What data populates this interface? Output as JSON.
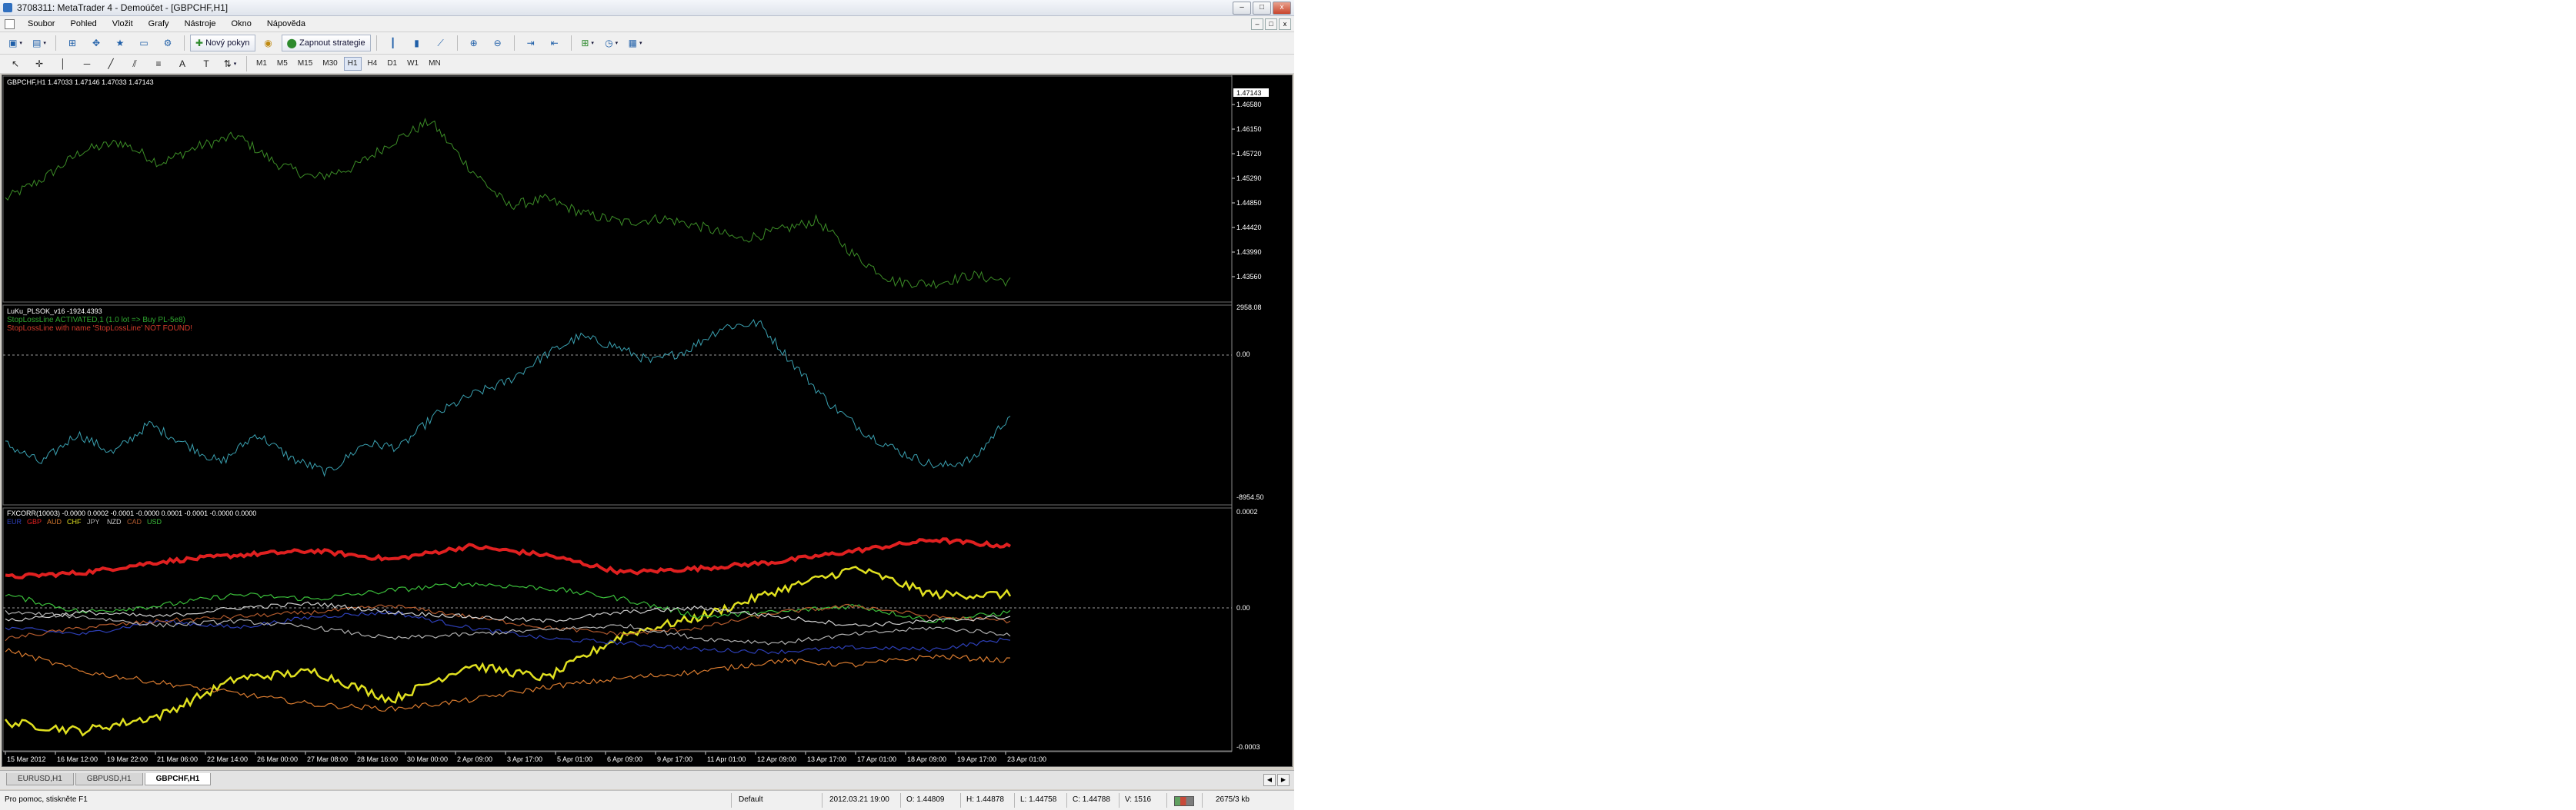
{
  "window": {
    "title": "3708311: MetaTrader 4 - Demoúčet - [GBPCHF,H1]",
    "controls": [
      "–",
      "□",
      "x"
    ]
  },
  "menu": {
    "items": [
      "Soubor",
      "Pohled",
      "Vložit",
      "Grafy",
      "Nástroje",
      "Okno",
      "Nápověda"
    ],
    "child_controls": [
      "–",
      "□",
      "x"
    ]
  },
  "toolbar": {
    "new_order_label": "Nový pokyn",
    "strategies_label": "Zapnout strategie",
    "timeframes": [
      "M1",
      "M5",
      "M15",
      "M30",
      "H1",
      "H4",
      "D1",
      "W1",
      "MN"
    ],
    "active_timeframe": "H1"
  },
  "chart": {
    "price_header": "GBPCHF,H1  1.47033 1.47146 1.47033 1.47143",
    "price_current_label": "1.47143",
    "price_axis": [
      "1.46580",
      "1.46150",
      "1.45720",
      "1.45290",
      "1.44850",
      "1.44420",
      "1.43990",
      "1.43560"
    ],
    "price_series_color": "#3c8d27",
    "ind1_header": "LuKu_PLSOK_v16 -1924.4393",
    "ind1_line1": "StopLossLine ACTIVATED,1 (1.0 lot => Buy PL-5e8)",
    "ind1_line2": "StopLossLine with name 'StopLossLine' NOT FOUND!",
    "ind1_line1_color": "#2ea52e",
    "ind1_line2_color": "#d23b2b",
    "ind1_axis": [
      "2958.08",
      "0.00",
      "-8954.50"
    ],
    "ind1_series_color": "#3aa0b0",
    "ind2_header": "FXCORR(10003) -0.0000 0.0002 -0.0001 -0.0000 0.0001 -0.0001 -0.0000 0.0000",
    "ind2_legend": [
      {
        "name": "EUR",
        "color": "#2d3fb7"
      },
      {
        "name": "GBP",
        "color": "#e02020"
      },
      {
        "name": "AUD",
        "color": "#d77a2f"
      },
      {
        "name": "CHF",
        "color": "#e0e020"
      },
      {
        "name": "JPY",
        "color": "#b0b0b0"
      },
      {
        "name": "NZD",
        "color": "#d0d0d0"
      },
      {
        "name": "CAD",
        "color": "#b15a2e"
      },
      {
        "name": "USD",
        "color": "#3bbf3b"
      }
    ],
    "ind2_axis": [
      "0.0002",
      "0.00",
      "-0.0003"
    ],
    "time_axis": [
      "15 Mar 2012",
      "16 Mar 12:00",
      "19 Mar 22:00",
      "21 Mar 06:00",
      "22 Mar 14:00",
      "26 Mar 00:00",
      "27 Mar 08:00",
      "28 Mar 16:00",
      "30 Mar 00:00",
      "2 Apr 09:00",
      "3 Apr 17:00",
      "5 Apr 01:00",
      "6 Apr 09:00",
      "9 Apr 17:00",
      "11 Apr 01:00",
      "12 Apr 09:00",
      "13 Apr 17:00",
      "17 Apr 01:00",
      "18 Apr 09:00",
      "19 Apr 17:00",
      "23 Apr 01:00"
    ]
  },
  "tabs": [
    "EURUSD,H1",
    "GBPUSD,H1",
    "GBPCHF,H1"
  ],
  "active_tab": "GBPCHF,H1",
  "status": {
    "help": "Pro pomoc, stiskněte F1",
    "profile": "Default",
    "time": "2012.03.21 19:00",
    "open": "O: 1.44809",
    "high": "H: 1.44878",
    "low": "L: 1.44758",
    "close": "C: 1.44788",
    "volume": "V: 1516",
    "traffic": "2675/3 kb"
  }
}
